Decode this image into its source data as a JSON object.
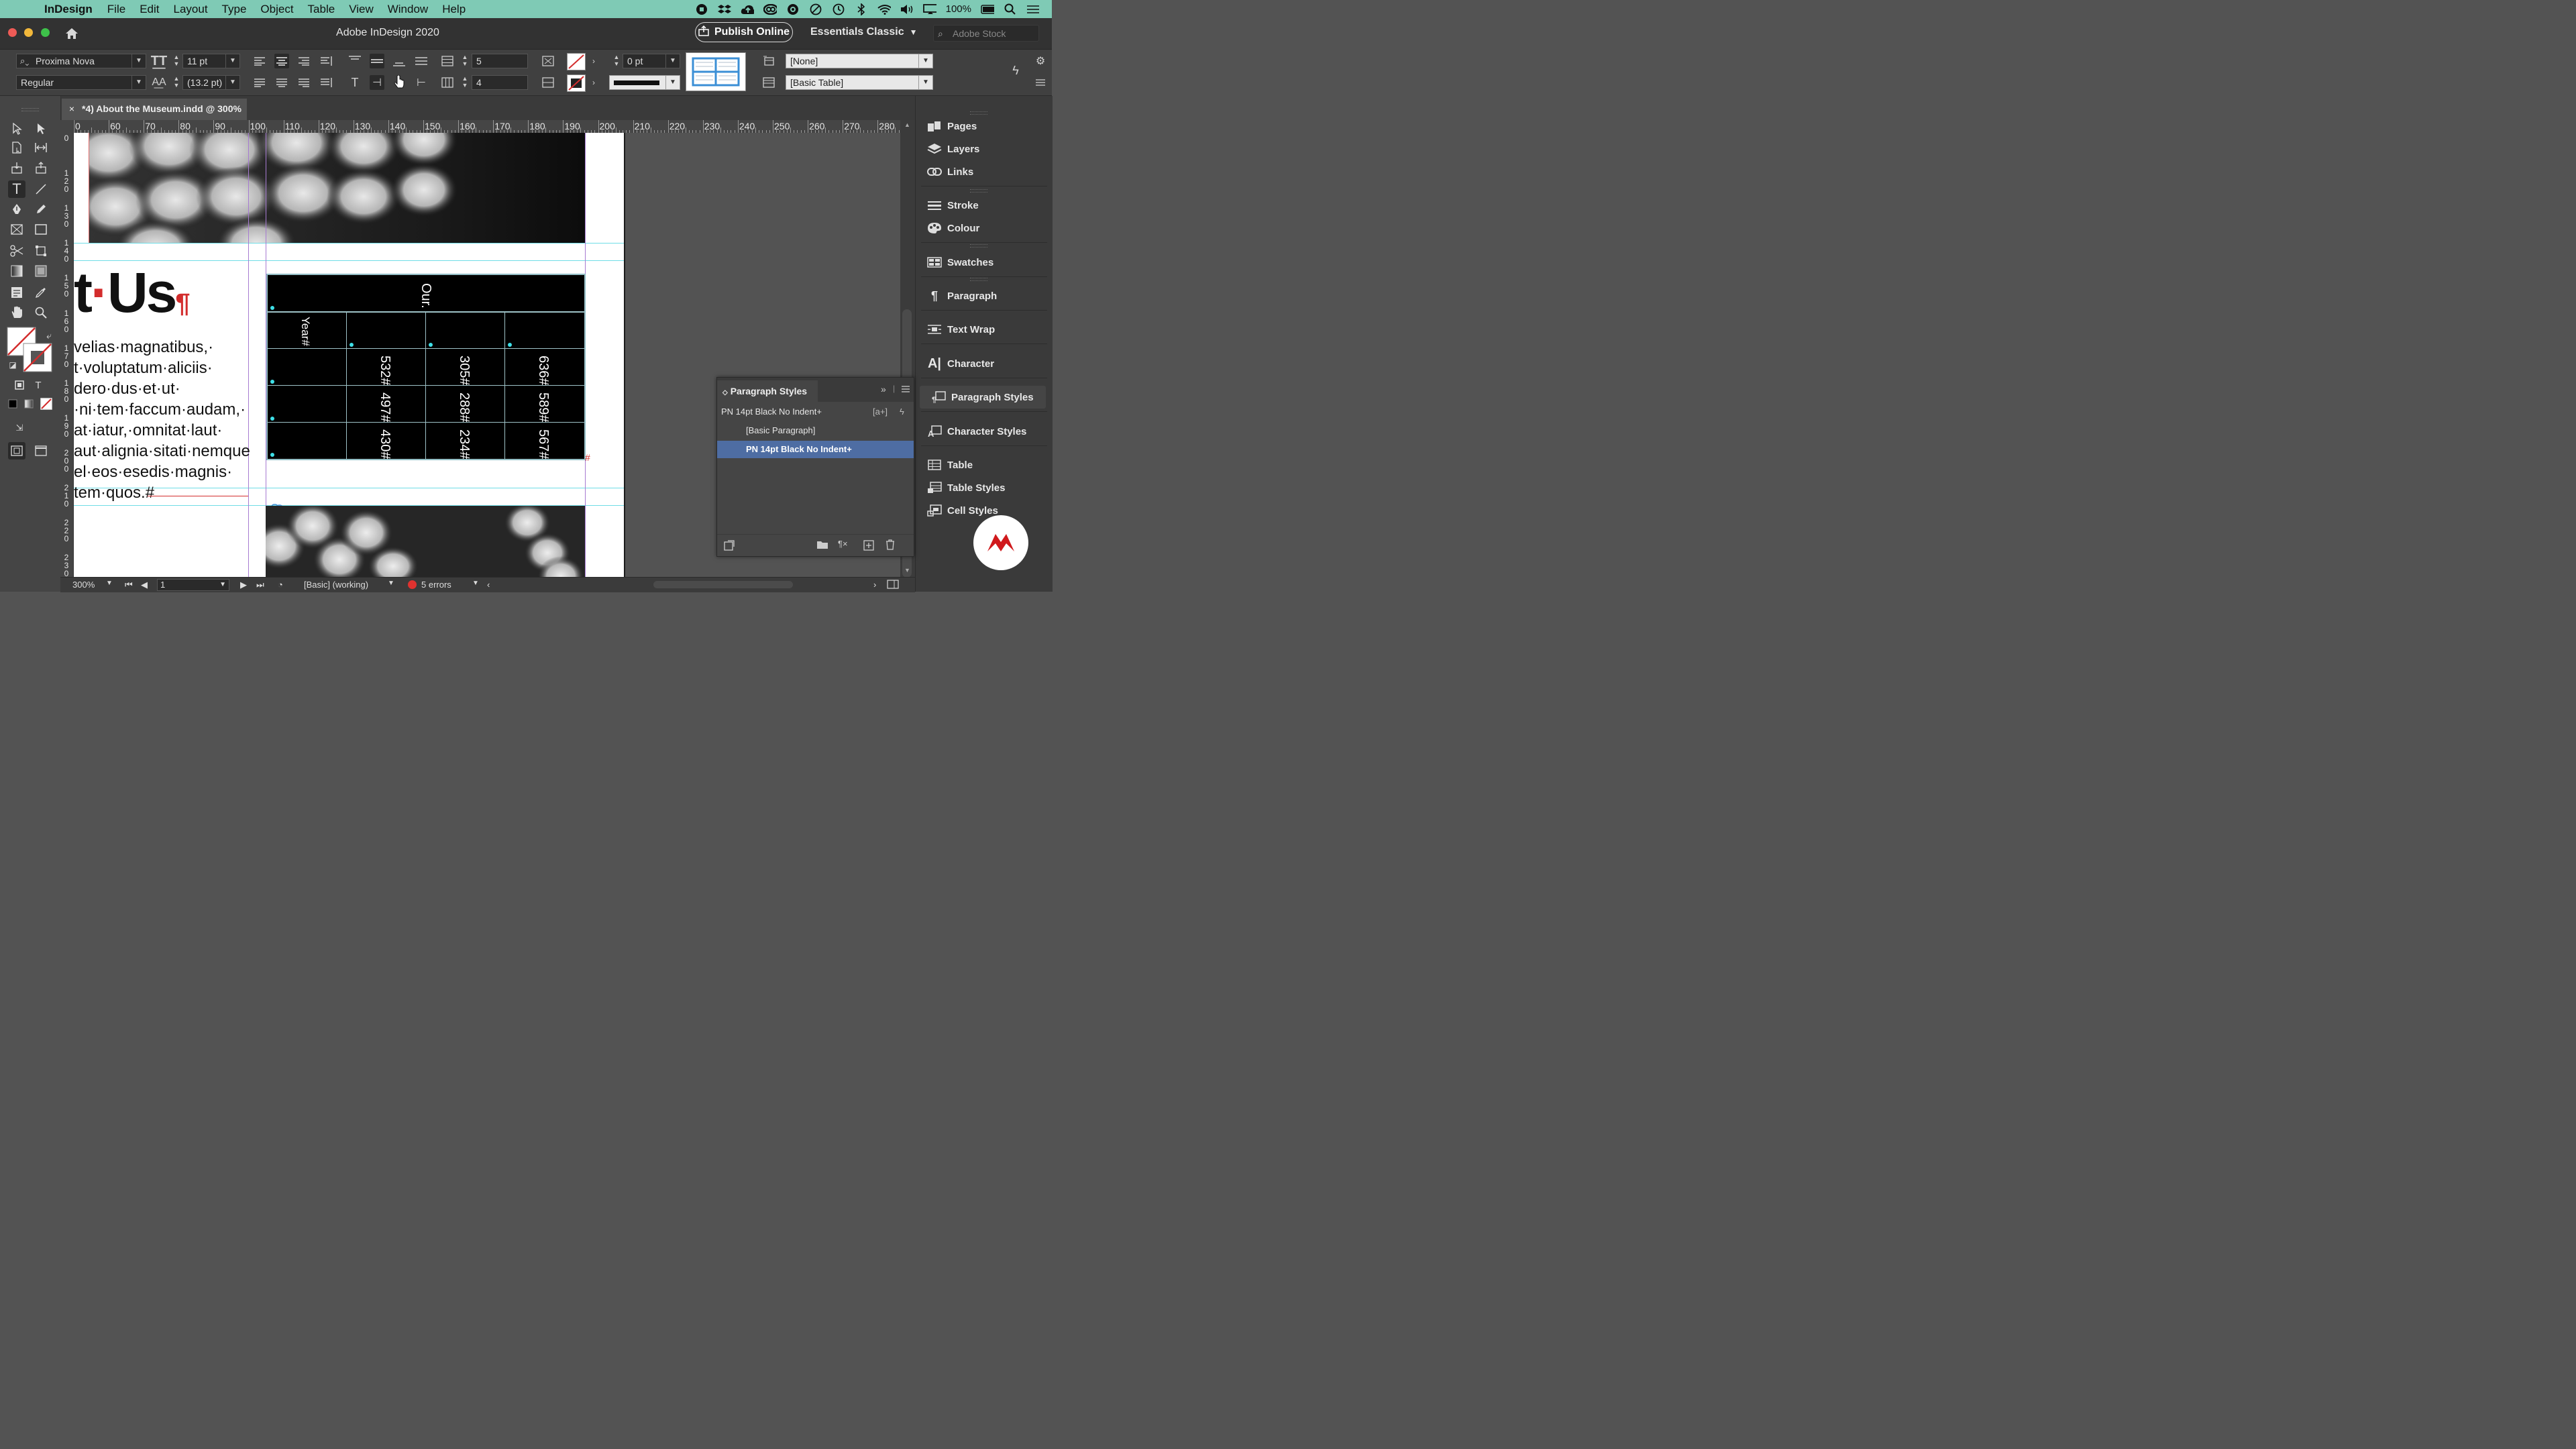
{
  "menubar": {
    "app_name": "InDesign",
    "items": [
      "File",
      "Edit",
      "Layout",
      "Type",
      "Object",
      "Table",
      "View",
      "Window",
      "Help"
    ],
    "battery": "100%",
    "icons": [
      "record-icon",
      "dropbox-icon",
      "cloud-upload-icon",
      "creative-cloud-icon",
      "app-icon",
      "pause-icon",
      "time-machine-icon",
      "bluetooth-icon",
      "wifi-icon",
      "volume-icon",
      "display-icon",
      "battery-icon",
      "spotlight-icon",
      "notification-center-icon"
    ]
  },
  "titlebar": {
    "title": "Adobe InDesign 2020",
    "publish_label": "Publish Online",
    "workspace": "Essentials Classic",
    "stock_placeholder": "Adobe Stock"
  },
  "control": {
    "font_family": "Proxima Nova",
    "font_style": "Regular",
    "font_size": "11 pt",
    "leading": "(13.2 pt)",
    "rows": "5",
    "columns": "4",
    "stroke_weight": "0 pt",
    "table_style": "[None]",
    "cell_style": "[Basic Table]"
  },
  "document": {
    "tab_title": "*4) About the Museum.indd @ 300%"
  },
  "ruler": {
    "h_labels": [
      "0",
      "60",
      "70",
      "80",
      "90",
      "100",
      "110",
      "120",
      "130",
      "140",
      "150",
      "160",
      "170",
      "180",
      "190",
      "200",
      "210",
      "220",
      "230",
      "240",
      "250",
      "260",
      "270",
      "280"
    ],
    "v_labels": [
      [
        "0"
      ],
      [
        "1",
        "2",
        "0"
      ],
      [
        "1",
        "3",
        "0"
      ],
      [
        "1",
        "4",
        "0"
      ],
      [
        "1",
        "5",
        "0"
      ],
      [
        "1",
        "6",
        "0"
      ],
      [
        "1",
        "7",
        "0"
      ],
      [
        "1",
        "8",
        "0"
      ],
      [
        "1",
        "9",
        "0"
      ],
      [
        "2",
        "0",
        "0"
      ],
      [
        "2",
        "1",
        "0"
      ],
      [
        "2",
        "2",
        "0"
      ],
      [
        "2",
        "3",
        "0"
      ]
    ]
  },
  "content": {
    "heading_part1": "t",
    "heading_dot": "·",
    "heading_part2": "Us",
    "pilcrow": "¶",
    "body_lines": [
      "velias·magnatibus,·",
      "t·voluptatum·aliciis·",
      "dero·dus·et·ut·",
      "·ni·tem·faccum·audam,·",
      "at·iatur,·omnitat·laut·",
      "aut·alignia·sitati·nemque",
      "el·eos·esedis·magnis·",
      "tem·quos.#"
    ]
  },
  "table": {
    "header": "Our.",
    "subheader": "Year#",
    "rows": [
      [
        "",
        "532#",
        "305#",
        "636#"
      ],
      [
        "",
        "497#",
        "288#",
        "589#"
      ],
      [
        "",
        "430#",
        "234#",
        "567#"
      ]
    ]
  },
  "status": {
    "zoom": "300%",
    "page": "1",
    "style": "[Basic] (working)",
    "errors": "5 errors"
  },
  "dock": {
    "items": [
      "Pages",
      "Layers",
      "Links",
      "Stroke",
      "Colour",
      "Swatches",
      "Paragraph",
      "Text Wrap",
      "Character",
      "Paragraph Styles",
      "Character Styles",
      "Table",
      "Table Styles",
      "Cell Styles"
    ]
  },
  "paragraph_styles": {
    "title": "Paragraph Styles",
    "current": "PN 14pt Black No Indent+",
    "items": [
      "[Basic Paragraph]",
      "PN 14pt Black No Indent+"
    ]
  },
  "colors": {
    "menubar": "#7fcab5",
    "selection": "#4e6da3",
    "error_red": "#d32d2d",
    "accent_cyan": "#3fe0e8"
  }
}
